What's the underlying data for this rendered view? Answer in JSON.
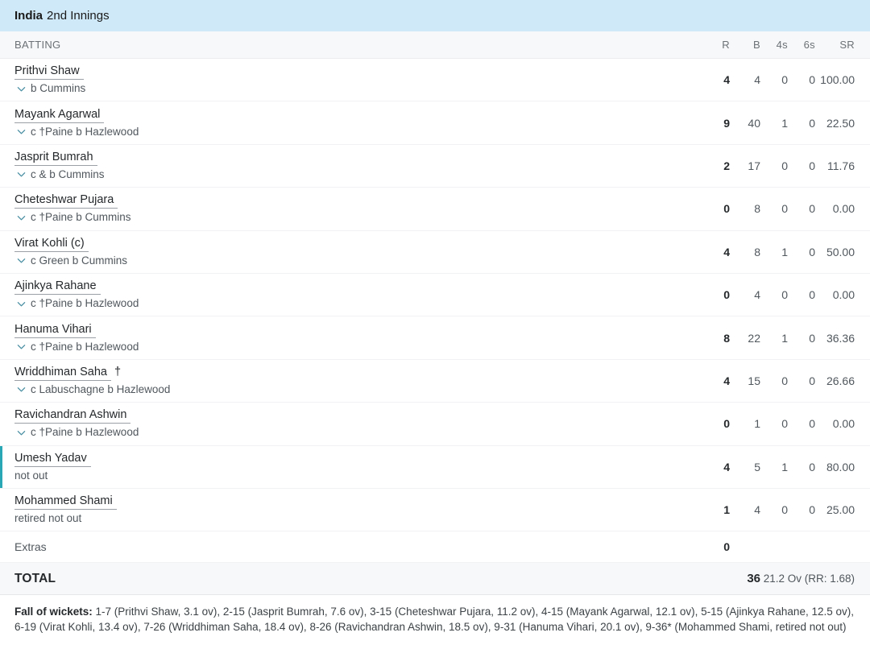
{
  "innings": {
    "team": "India",
    "label": "2nd Innings"
  },
  "columns": {
    "batting": "BATTING",
    "runs": "R",
    "balls": "B",
    "fours": "4s",
    "sixes": "6s",
    "strike_rate": "SR"
  },
  "batsmen": [
    {
      "name": "Prithvi Shaw",
      "suffix": "",
      "dismissal": "b Cummins",
      "not_out": false,
      "has_chevron": true,
      "R": "4",
      "B": "4",
      "4s": "0",
      "6s": "0",
      "SR": "100.00"
    },
    {
      "name": "Mayank Agarwal",
      "suffix": "",
      "dismissal": "c †Paine b Hazlewood",
      "not_out": false,
      "has_chevron": true,
      "R": "9",
      "B": "40",
      "4s": "1",
      "6s": "0",
      "SR": "22.50"
    },
    {
      "name": "Jasprit Bumrah",
      "suffix": "",
      "dismissal": "c & b Cummins",
      "not_out": false,
      "has_chevron": true,
      "R": "2",
      "B": "17",
      "4s": "0",
      "6s": "0",
      "SR": "11.76"
    },
    {
      "name": "Cheteshwar Pujara",
      "suffix": "",
      "dismissal": "c †Paine b Cummins",
      "not_out": false,
      "has_chevron": true,
      "R": "0",
      "B": "8",
      "4s": "0",
      "6s": "0",
      "SR": "0.00"
    },
    {
      "name": "Virat Kohli (c)",
      "suffix": "",
      "dismissal": "c Green b Cummins",
      "not_out": false,
      "has_chevron": true,
      "R": "4",
      "B": "8",
      "4s": "1",
      "6s": "0",
      "SR": "50.00"
    },
    {
      "name": "Ajinkya Rahane",
      "suffix": "",
      "dismissal": "c †Paine b Hazlewood",
      "not_out": false,
      "has_chevron": true,
      "R": "0",
      "B": "4",
      "4s": "0",
      "6s": "0",
      "SR": "0.00"
    },
    {
      "name": "Hanuma Vihari",
      "suffix": "",
      "dismissal": "c †Paine b Hazlewood",
      "not_out": false,
      "has_chevron": true,
      "R": "8",
      "B": "22",
      "4s": "1",
      "6s": "0",
      "SR": "36.36"
    },
    {
      "name": "Wriddhiman Saha",
      "suffix": "†",
      "dismissal": "c Labuschagne b Hazlewood",
      "not_out": false,
      "has_chevron": true,
      "R": "4",
      "B": "15",
      "4s": "0",
      "6s": "0",
      "SR": "26.66"
    },
    {
      "name": "Ravichandran Ashwin",
      "suffix": "",
      "dismissal": "c †Paine b Hazlewood",
      "not_out": false,
      "has_chevron": true,
      "R": "0",
      "B": "1",
      "4s": "0",
      "6s": "0",
      "SR": "0.00"
    },
    {
      "name": "Umesh Yadav",
      "suffix": "",
      "dismissal": "not out",
      "not_out": true,
      "has_chevron": false,
      "R": "4",
      "B": "5",
      "4s": "1",
      "6s": "0",
      "SR": "80.00"
    },
    {
      "name": "Mohammed Shami",
      "suffix": "",
      "dismissal": "retired not out",
      "not_out": false,
      "has_chevron": false,
      "R": "1",
      "B": "4",
      "4s": "0",
      "6s": "0",
      "SR": "25.00"
    }
  ],
  "extras": {
    "label": "Extras",
    "value": "0"
  },
  "total": {
    "label": "TOTAL",
    "runs": "36",
    "overs": "21.2 Ov (RR: 1.68)"
  },
  "fall_of_wickets": {
    "label": "Fall of wickets:",
    "text": " 1-7 (Prithvi Shaw, 3.1 ov), 2-15 (Jasprit Bumrah, 7.6 ov), 3-15 (Cheteshwar Pujara, 11.2 ov), 4-15 (Mayank Agarwal, 12.1 ov), 5-15 (Ajinkya Rahane, 12.5 ov), 6-19 (Virat Kohli, 13.4 ov), 7-26 (Wriddhiman Saha, 18.4 ov), 8-26 (Ravichandran Ashwin, 18.5 ov), 9-31 (Hanuma Vihari, 20.1 ov), 9-36* (Mohammed Shami, retired not out)"
  },
  "colors": {
    "header_bg": "#cfe9f8",
    "not_out_accent": "#2aa7b5",
    "chevron": "#4a8fa3"
  }
}
